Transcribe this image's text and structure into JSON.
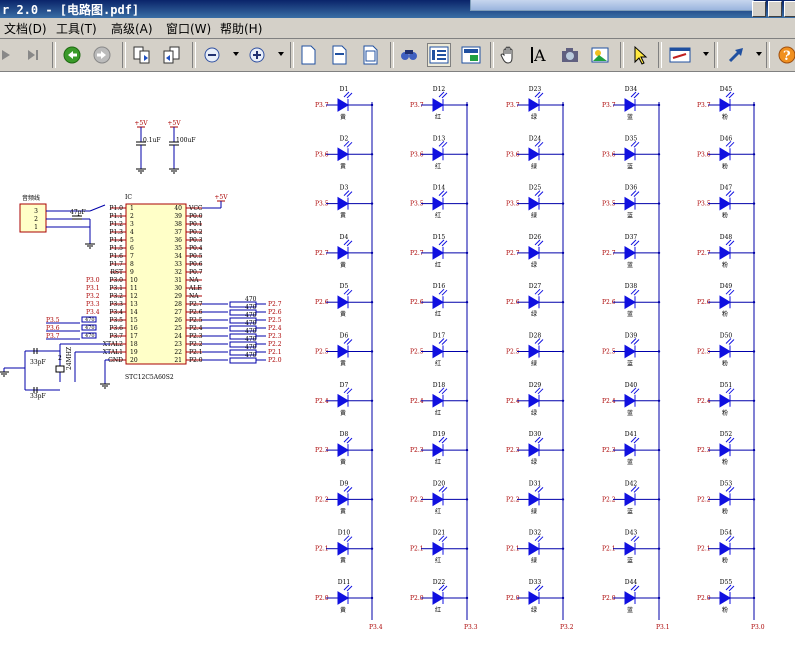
{
  "window": {
    "title": "r 2.0 - [电路图.pdf]"
  },
  "menu": {
    "items": [
      {
        "label": "文档(D)"
      },
      {
        "label": "工具(T)"
      },
      {
        "label": "高级(A)"
      },
      {
        "label": "窗口(W)"
      },
      {
        "label": "帮助(H)"
      }
    ]
  },
  "toolbar": {
    "icons": [
      "play-icon",
      "last-page-icon",
      "back-icon",
      "forward-icon",
      "two-page-icon",
      "facing-icon",
      "zoom-out-icon",
      "zoom-in-icon",
      "page-icon",
      "page-width-icon",
      "page-fit-icon",
      "find-icon",
      "text-view-icon",
      "image-view-icon",
      "hand-icon",
      "select-text-icon",
      "snapshot-icon",
      "photo-icon",
      "pointer-icon",
      "link-icon",
      "arrow-tool-icon",
      "help-icon"
    ]
  },
  "schematic": {
    "power": {
      "vcc1": "+5V",
      "vcc2": "+5V",
      "cap1": "0.1uF",
      "cap2": "100uF",
      "vcc_pin": "+5V"
    },
    "audio": {
      "title": "音频线",
      "pins": [
        "3",
        "2",
        "1"
      ],
      "cap": "47pF"
    },
    "mcu": {
      "name": "STC12C5A60S2",
      "ic_label": "IC",
      "left_pins": [
        {
          "n": "1",
          "name": "P1.0"
        },
        {
          "n": "2",
          "name": "P1.1"
        },
        {
          "n": "3",
          "name": "P1.2"
        },
        {
          "n": "4",
          "name": "P1.3"
        },
        {
          "n": "5",
          "name": "P1.4"
        },
        {
          "n": "6",
          "name": "P1.5"
        },
        {
          "n": "7",
          "name": "P1.6"
        },
        {
          "n": "8",
          "name": "P1.7"
        },
        {
          "n": "9",
          "name": "RST"
        },
        {
          "n": "10",
          "name": "P3.0"
        },
        {
          "n": "11",
          "name": "P3.1"
        },
        {
          "n": "12",
          "name": "P3.2"
        },
        {
          "n": "13",
          "name": "P3.3"
        },
        {
          "n": "14",
          "name": "P3.4"
        },
        {
          "n": "15",
          "name": "P3.5"
        },
        {
          "n": "16",
          "name": "P3.6"
        },
        {
          "n": "17",
          "name": "P3.7"
        },
        {
          "n": "18",
          "name": "XTAL2"
        },
        {
          "n": "19",
          "name": "XTAL1"
        },
        {
          "n": "20",
          "name": "GND"
        }
      ],
      "right_pins": [
        {
          "n": "40",
          "name": "VCC"
        },
        {
          "n": "39",
          "name": "P0.0"
        },
        {
          "n": "38",
          "name": "P0.1"
        },
        {
          "n": "37",
          "name": "P0.2"
        },
        {
          "n": "36",
          "name": "P0.3"
        },
        {
          "n": "35",
          "name": "P0.4"
        },
        {
          "n": "34",
          "name": "P0.5"
        },
        {
          "n": "33",
          "name": "P0.6"
        },
        {
          "n": "32",
          "name": "P0.7"
        },
        {
          "n": "31",
          "name": "NA"
        },
        {
          "n": "30",
          "name": "ALE"
        },
        {
          "n": "29",
          "name": "NA"
        },
        {
          "n": "28",
          "name": "P2.7"
        },
        {
          "n": "27",
          "name": "P2.6"
        },
        {
          "n": "26",
          "name": "P2.5"
        },
        {
          "n": "25",
          "name": "P2.4"
        },
        {
          "n": "24",
          "name": "P2.3"
        },
        {
          "n": "23",
          "name": "P2.2"
        },
        {
          "n": "22",
          "name": "P2.1"
        },
        {
          "n": "21",
          "name": "P2.0"
        }
      ],
      "left_nets": [
        "P3.0",
        "P3.1",
        "P3.2",
        "P3.3",
        "P3.4"
      ],
      "left_res_nets": [
        "P3.5",
        "P3.6",
        "P3.7"
      ],
      "res_value": "470",
      "right_res_nets": [
        "P2.7",
        "P2.6",
        "P2.5",
        "P2.4",
        "P2.3",
        "P2.2",
        "P2.1",
        "P2.0"
      ]
    },
    "crystal": {
      "cap1": "33pF",
      "cap2": "33pF",
      "freq": "24MHZ",
      "pin": "2"
    },
    "led_rows": [
      "P2.7",
      "P2.6",
      "P2.5",
      "P2.4",
      "P2.3",
      "P2.2",
      "P2.1",
      "P2.0"
    ],
    "led_rows_top": [
      "P3.7",
      "P3.6",
      "P3.5"
    ],
    "led_columns": [
      {
        "start": 1,
        "color": "黄",
        "bus": "P3.4"
      },
      {
        "start": 12,
        "color": "红",
        "bus": "P3.3"
      },
      {
        "start": 23,
        "color": "绿",
        "bus": "P3.2"
      },
      {
        "start": 34,
        "color": "蓝",
        "bus": "P3.1"
      },
      {
        "start": 45,
        "color": "粉",
        "bus": "P3.0"
      }
    ]
  },
  "colors": {
    "wire": "#0000aa",
    "net": "#aa0000",
    "led": "#1010e0",
    "ic_fill": "#ffffc8",
    "ic_stroke": "#aa0000"
  }
}
